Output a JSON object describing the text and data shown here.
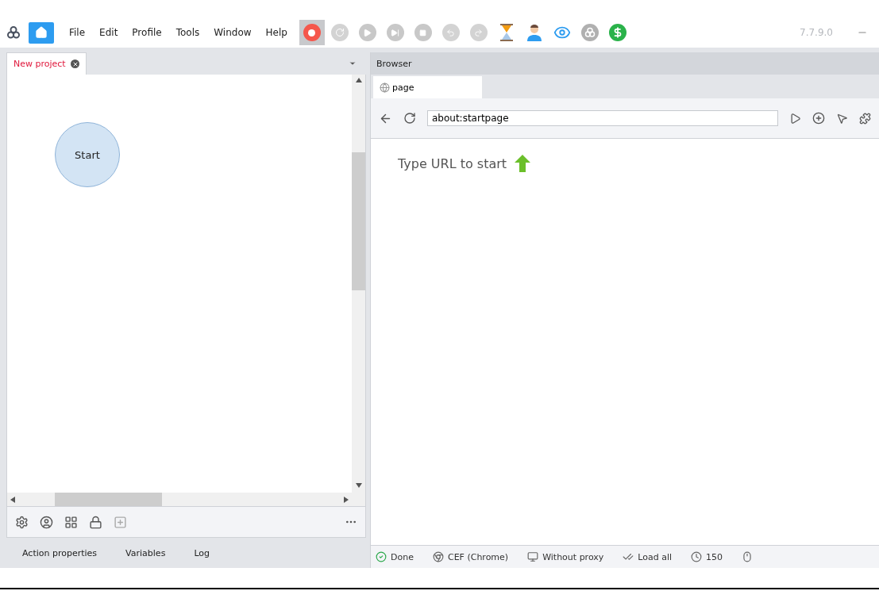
{
  "menu": [
    "File",
    "Edit",
    "Profile",
    "Tools",
    "Window",
    "Help"
  ],
  "toolbar": [
    {
      "kind": "record",
      "selected": true,
      "disabled": false
    },
    {
      "kind": "refresh",
      "selected": false,
      "disabled": true
    },
    {
      "kind": "play",
      "selected": false,
      "disabled": true
    },
    {
      "kind": "step",
      "selected": false,
      "disabled": true
    },
    {
      "kind": "stop",
      "selected": false,
      "disabled": true
    },
    {
      "kind": "undo",
      "selected": false,
      "disabled": true
    },
    {
      "kind": "redo",
      "selected": false,
      "disabled": true
    },
    {
      "kind": "hourglass",
      "selected": false,
      "disabled": false
    },
    {
      "kind": "person",
      "selected": false,
      "disabled": false
    },
    {
      "kind": "eye",
      "selected": false,
      "disabled": false
    },
    {
      "kind": "logo",
      "selected": false,
      "disabled": false
    },
    {
      "kind": "dollar",
      "selected": false,
      "disabled": false
    }
  ],
  "version": "7.7.9.0",
  "project_tabs": [
    {
      "label": "New project",
      "selected": true
    }
  ],
  "canvas": {
    "nodes": [
      {
        "label": "Start"
      }
    ]
  },
  "bottom_tabs": [
    "Action properties",
    "Variables",
    "Log"
  ],
  "browser": {
    "title": "Browser",
    "tabs": [
      {
        "label": "page",
        "selected": true
      }
    ],
    "url": "about:startpage",
    "hint": "Type URL to start",
    "status": [
      {
        "kind": "done",
        "text": "Done"
      },
      {
        "kind": "engine",
        "text": "CEF (Chrome)"
      },
      {
        "kind": "proxy",
        "text": "Without proxy"
      },
      {
        "kind": "load",
        "text": "Load all"
      },
      {
        "kind": "timer",
        "text": "150"
      },
      {
        "kind": "mouse"
      }
    ]
  }
}
